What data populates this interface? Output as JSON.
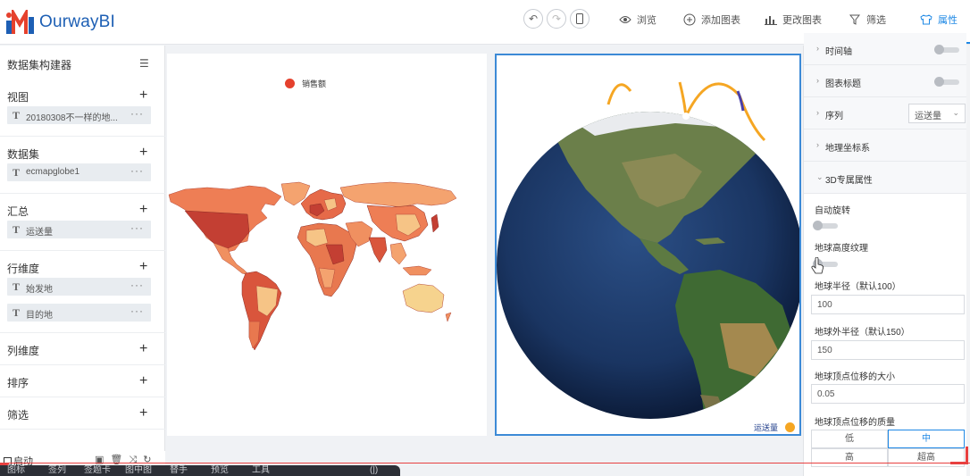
{
  "app": {
    "logo_text": "OurwayBI"
  },
  "toolbar": {
    "undo": "↶",
    "redo": "↷",
    "mobile": "▯",
    "items": [
      {
        "label": "浏览",
        "icon": "eye-icon"
      },
      {
        "label": "添加图表",
        "icon": "plus-circle-icon"
      },
      {
        "label": "更改图表",
        "icon": "bar-chart-icon"
      },
      {
        "label": "筛选",
        "icon": "filter-icon"
      },
      {
        "label": "属性",
        "icon": "shirt-icon",
        "active": true
      }
    ]
  },
  "left_panel": {
    "title": "数据集构建器",
    "sections": [
      {
        "title": "视图",
        "fields": [
          "20180308不一样的地..."
        ]
      },
      {
        "title": "数据集",
        "fields": [
          "ecmapglobe1"
        ]
      },
      {
        "title": "汇总",
        "fields": [
          "运送量"
        ]
      },
      {
        "title": "行维度",
        "fields": [
          "始发地",
          "目的地"
        ]
      },
      {
        "title": "列维度",
        "fields": []
      },
      {
        "title": "排序",
        "fields": []
      },
      {
        "title": "筛选",
        "fields": []
      }
    ],
    "field_type_glyph": "T",
    "more_glyph": "···",
    "add_glyph": "+"
  },
  "map_chart": {
    "legend": "销售额",
    "legend_color": "#e5412d"
  },
  "globe_chart": {
    "legend": "运送量",
    "legend_color": "#f5a623"
  },
  "right_panel": {
    "rows": [
      {
        "label": "时间轴",
        "toggle": false
      },
      {
        "label": "图表标题",
        "toggle": false
      },
      {
        "label": "序列",
        "select": "运送量"
      },
      {
        "label": "地理坐标系"
      },
      {
        "label": "3D专属属性",
        "expanded": true
      }
    ],
    "props": [
      {
        "label": "自动旋转",
        "type": "toggle",
        "on": false
      },
      {
        "label": "地球高度纹理",
        "type": "toggle",
        "on": false
      },
      {
        "label": "地球半径（默认100）",
        "type": "input",
        "value": "100"
      },
      {
        "label": "地球外半径（默认150）",
        "type": "input",
        "value": "150"
      },
      {
        "label": "地球顶点位移的大小",
        "type": "input",
        "value": "0.05"
      },
      {
        "label": "地球顶点位移的质量",
        "type": "buttons"
      }
    ],
    "quality_options": [
      "低",
      "中",
      "高",
      "超高"
    ],
    "quality_selected": "中"
  },
  "bottom": {
    "autostart_label": "启动",
    "icons": [
      "▣",
      "🗑",
      "⤨",
      "↻"
    ],
    "dark_bar_items": [
      "图标",
      "签列",
      "签题卡",
      "图中图",
      "替手",
      "预览",
      "工具",
      "(|)"
    ]
  },
  "colors": {
    "accent": "#1e88e5",
    "brand": "#1d5fb4",
    "map_high": "#c0302a",
    "map_low": "#f6d38e",
    "ocean": "#1d3a66"
  }
}
